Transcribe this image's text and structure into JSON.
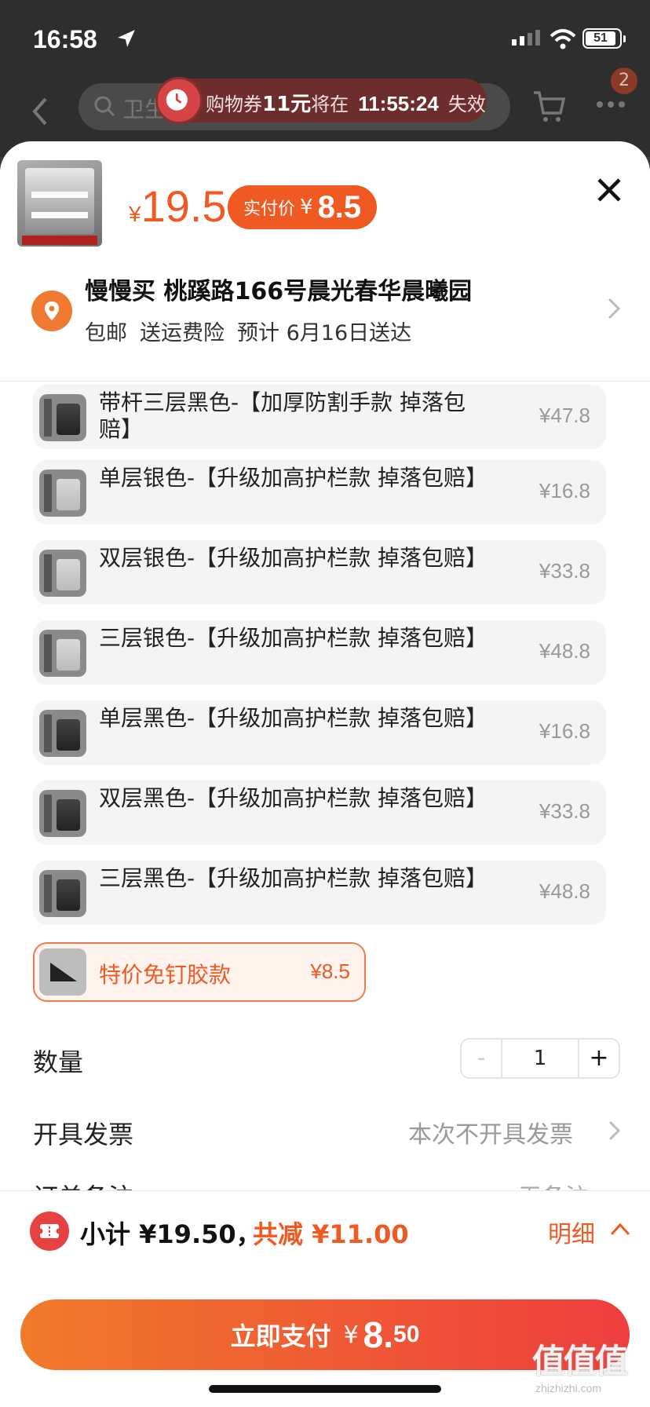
{
  "status": {
    "time": "16:58",
    "battery": "51"
  },
  "nav": {
    "search_text": "卫生",
    "cart_count": "2"
  },
  "coupon": {
    "prefix": "购物券",
    "amount": "11元",
    "middle": "将在",
    "countdown": "11:55:24",
    "suffix": "失效"
  },
  "product": {
    "currency": "¥",
    "price": "19.5",
    "pay_label": "实付价",
    "pay_currency": "¥",
    "pay_value": "8.5"
  },
  "address": {
    "line1": "慢慢买 桃蹊路166号晨光春华晨曦园",
    "tags": [
      "包邮",
      "送运费险",
      "预计 6月16日送达"
    ]
  },
  "options": [
    {
      "label": "带杆三层黑色-【加厚防割手款 掉落包赔】",
      "price": "¥47.8",
      "dark": true
    },
    {
      "label": "单层银色-【升级加高护栏款 掉落包赔】",
      "price": "¥16.8",
      "dark": false
    },
    {
      "label": "双层银色-【升级加高护栏款 掉落包赔】",
      "price": "¥33.8",
      "dark": false
    },
    {
      "label": "三层银色-【升级加高护栏款 掉落包赔】",
      "price": "¥48.8",
      "dark": false
    },
    {
      "label": "单层黑色-【升级加高护栏款 掉落包赔】",
      "price": "¥16.8",
      "dark": true
    },
    {
      "label": "双层黑色-【升级加高护栏款 掉落包赔】",
      "price": "¥33.8",
      "dark": true
    },
    {
      "label": "三层黑色-【升级加高护栏款 掉落包赔】",
      "price": "¥48.8",
      "dark": true
    }
  ],
  "selected_option": {
    "label": "特价免钉胶款",
    "price": "¥8.5"
  },
  "quantity": {
    "label": "数量",
    "minus": "-",
    "value": "1",
    "plus": "+"
  },
  "invoice": {
    "label": "开具发票",
    "value": "本次不开具发票"
  },
  "note": {
    "label": "订单备注",
    "value": "无备注"
  },
  "summary": {
    "subtotal": "小计 ¥19.50，",
    "saved": "共减 ¥11.00",
    "detail": "明细"
  },
  "pay_button": {
    "label": "立即支付",
    "currency": "¥",
    "integer": "8.",
    "decimal": "50"
  },
  "watermark": {
    "title": "值值值",
    "url": "zhizhizhi.com"
  },
  "colors": {
    "accent": "#f05a22",
    "pay_gradient_start": "#f07a2a",
    "pay_gradient_end": "#ee3d3d"
  }
}
